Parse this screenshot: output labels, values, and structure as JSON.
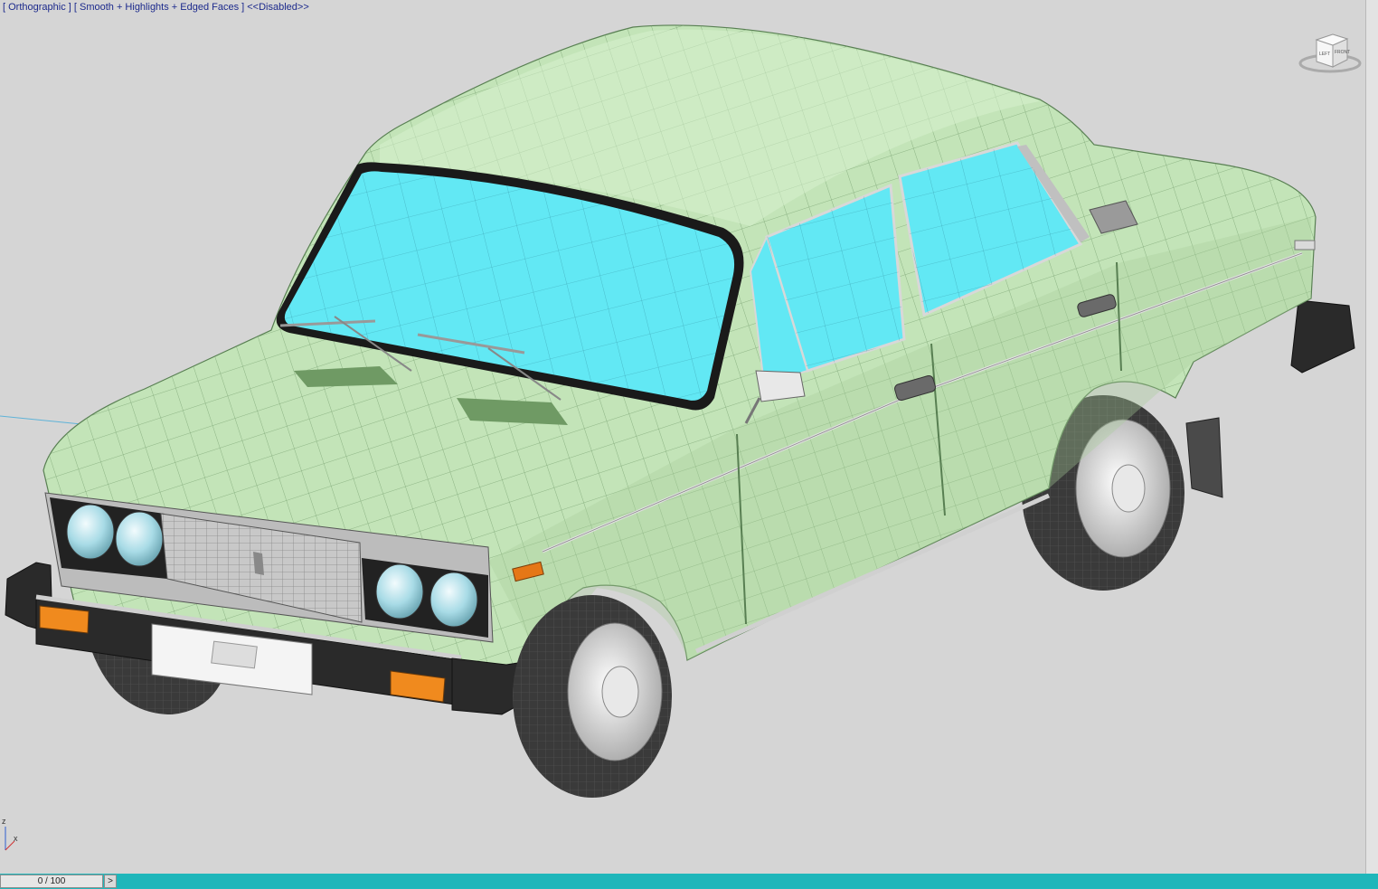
{
  "viewport": {
    "label": "[ Orthographic ] [ Smooth + Highlights + Edged Faces ] <<Disabled>>",
    "background": "#d5d5d5",
    "viewcube": {
      "left_face": "LEFT",
      "front_face": "FRONT"
    },
    "model": {
      "body_color": "#c3e4b8",
      "glass_color": "#62e8f4",
      "tire_color": "#333333",
      "bumper_color": "#2a2a2a",
      "indicator_color": "#f08a1e"
    }
  },
  "axis": {
    "z": "z",
    "x": "x"
  },
  "timeline": {
    "frame_readout": "0 / 100",
    "next_button": ">",
    "accent_color": "#20b8bc"
  }
}
